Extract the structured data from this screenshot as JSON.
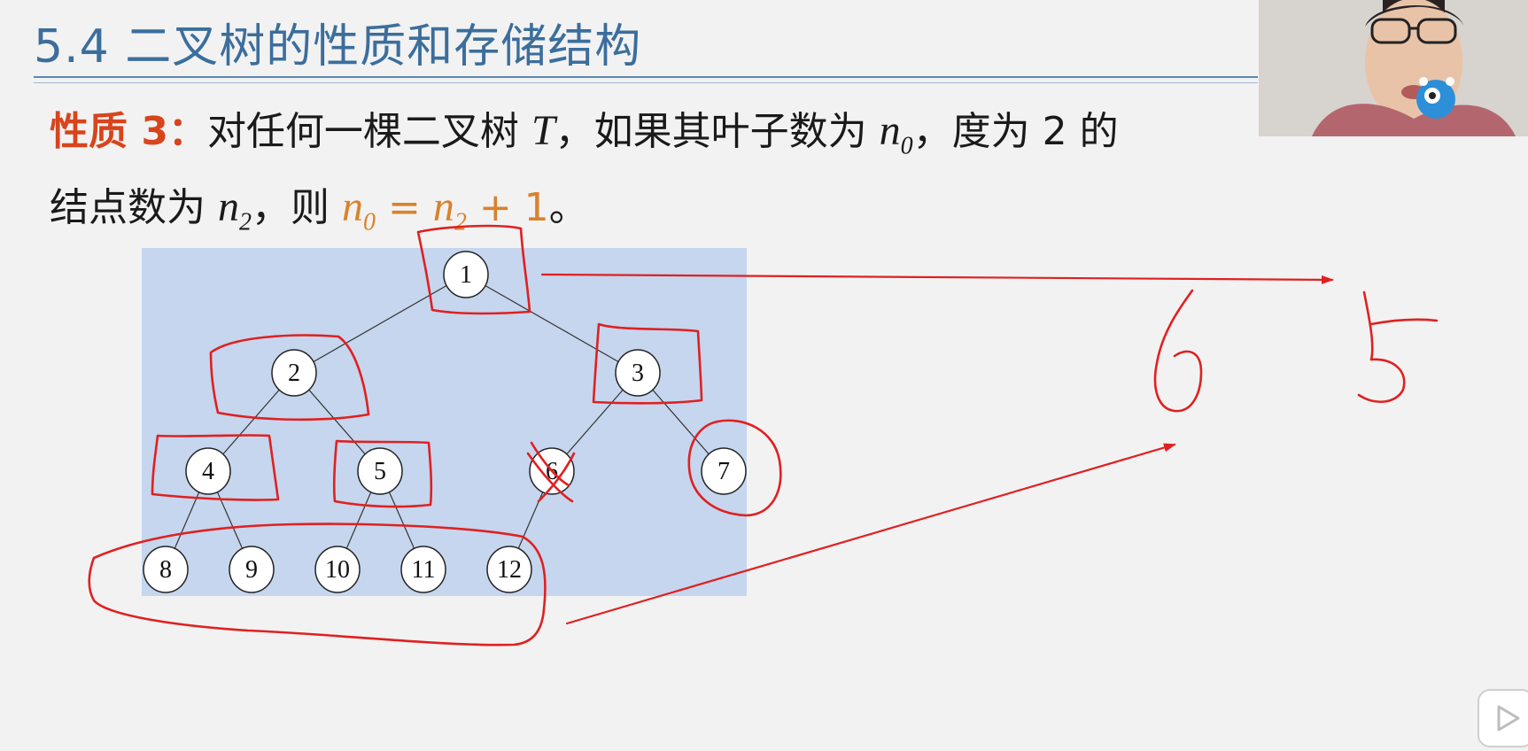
{
  "slide": {
    "title": "5.4 二叉树的性质和存储结构",
    "property_label": "性质 3：",
    "line1_a": "对任何一棵二叉树 ",
    "var_T": "T",
    "line1_b": "，如果其叶子数为 ",
    "var_n": "n",
    "sub_0": "0",
    "line1_c": "，度为 2 的",
    "line2_a": "结点数为 ",
    "sub_2": "2",
    "line2_b": "，则 ",
    "formula_eq": " = ",
    "formula_plus": " + 1",
    "line2_end": "。"
  },
  "tree": {
    "nodes": [
      {
        "id": "1",
        "label": "1"
      },
      {
        "id": "2",
        "label": "2"
      },
      {
        "id": "3",
        "label": "3"
      },
      {
        "id": "4",
        "label": "4"
      },
      {
        "id": "5",
        "label": "5"
      },
      {
        "id": "6",
        "label": "6"
      },
      {
        "id": "7",
        "label": "7"
      },
      {
        "id": "8",
        "label": "8"
      },
      {
        "id": "9",
        "label": "9"
      },
      {
        "id": "10",
        "label": "10"
      },
      {
        "id": "11",
        "label": "11"
      },
      {
        "id": "12",
        "label": "12"
      }
    ],
    "edges": [
      [
        "1",
        "2"
      ],
      [
        "1",
        "3"
      ],
      [
        "2",
        "4"
      ],
      [
        "2",
        "5"
      ],
      [
        "3",
        "6"
      ],
      [
        "3",
        "7"
      ],
      [
        "4",
        "8"
      ],
      [
        "4",
        "9"
      ],
      [
        "5",
        "10"
      ],
      [
        "5",
        "11"
      ],
      [
        "6",
        "12"
      ]
    ]
  },
  "annotations": {
    "handwritten_left": "6",
    "handwritten_right": "5",
    "ink_color": "#e02020"
  },
  "colors": {
    "title": "#3b6e9c",
    "property": "#d8441c",
    "formula": "#d9822b",
    "tree_panel": "#c5d6ee"
  },
  "icons": [
    "webcam-feed",
    "mascot-icon",
    "play-icon"
  ]
}
